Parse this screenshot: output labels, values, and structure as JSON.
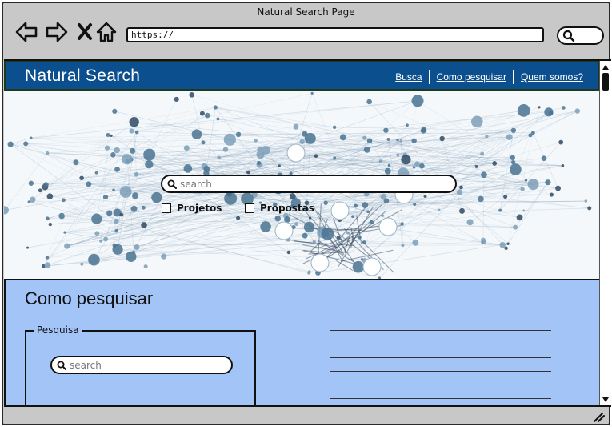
{
  "window": {
    "title": "Natural Search Page"
  },
  "browser": {
    "nav_icons": [
      "back-arrow-icon",
      "forward-arrow-icon",
      "close-x-icon",
      "home-icon"
    ],
    "url": "https://",
    "search_icon": "search-icon"
  },
  "header": {
    "title": "Natural Search",
    "nav": [
      {
        "label": "Busca"
      },
      {
        "label": "Como pesquisar"
      },
      {
        "label": "Quem somos?"
      }
    ],
    "bg_color": "#0b4f8e"
  },
  "hero": {
    "search_placeholder": "search",
    "checkboxes": [
      {
        "label": "Projetos",
        "checked": false
      },
      {
        "label": "Propostas",
        "checked": false
      }
    ]
  },
  "how_to": {
    "title": "Como pesquisar",
    "fieldset_legend": "Pesquisa",
    "search_placeholder": "search",
    "bg_color": "#a3c4f7"
  }
}
